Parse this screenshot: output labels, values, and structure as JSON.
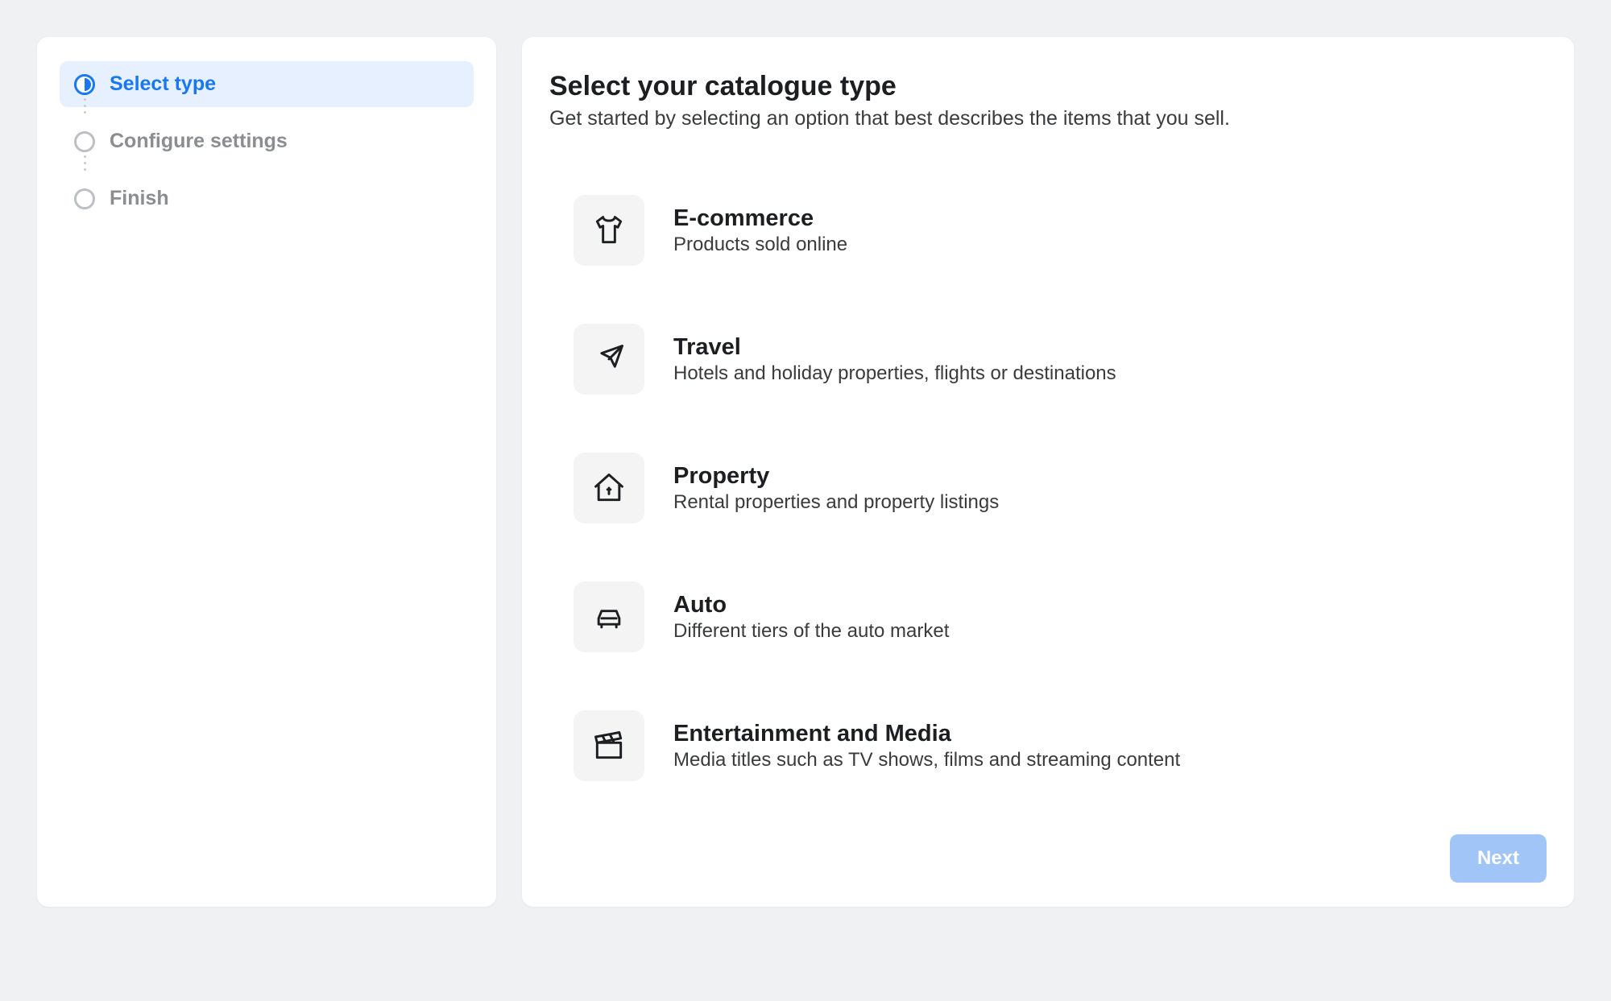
{
  "sidebar": {
    "steps": [
      {
        "label": "Select type",
        "active": true
      },
      {
        "label": "Configure settings",
        "active": false
      },
      {
        "label": "Finish",
        "active": false
      }
    ]
  },
  "header": {
    "title": "Select your catalogue type",
    "subtitle": "Get started by selecting an option that best describes the items that you sell."
  },
  "options": [
    {
      "icon": "tshirt-icon",
      "title": "E-commerce",
      "desc": "Products sold online"
    },
    {
      "icon": "plane-icon",
      "title": "Travel",
      "desc": "Hotels and holiday properties, flights or destinations"
    },
    {
      "icon": "house-icon",
      "title": "Property",
      "desc": "Rental properties and property listings"
    },
    {
      "icon": "car-icon",
      "title": "Auto",
      "desc": "Different tiers of the auto market"
    },
    {
      "icon": "clapper-icon",
      "title": "Entertainment and Media",
      "desc": "Media titles such as TV shows, films and streaming content"
    }
  ],
  "footer": {
    "next_label": "Next"
  }
}
